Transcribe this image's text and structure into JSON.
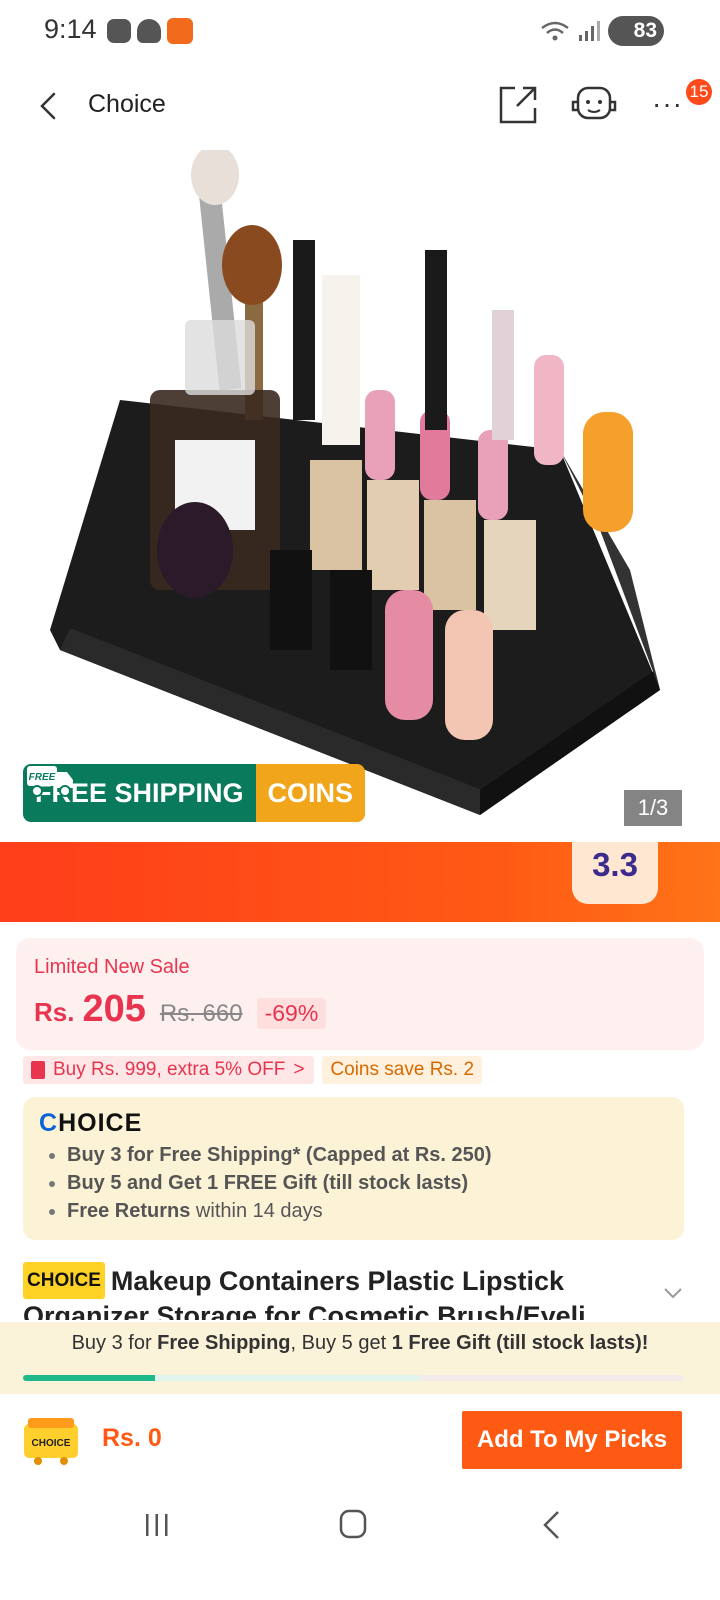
{
  "status_bar": {
    "time": "9:14",
    "battery": "83"
  },
  "header": {
    "title": "Choice",
    "notification_count": "15"
  },
  "gallery": {
    "counter": "1/3",
    "badge_free": "FREE",
    "shipping_label": "FREE SHIPPING",
    "coins_label": "COINS"
  },
  "promo": {
    "badge": "3.3"
  },
  "price": {
    "sale_label": "Limited New Sale",
    "currency": "Rs.",
    "current": "205",
    "original": "Rs. 660",
    "discount": "-69%"
  },
  "coupons": {
    "coupon": "Buy Rs. 999, extra 5% OFF",
    "coupon_chevron": ">",
    "coins": "Coins save Rs. 2"
  },
  "choice_box": {
    "logo": "CHOICE",
    "items": [
      {
        "bold": "Buy 3 for  Free Shipping* (Capped at Rs. 250)",
        "rest": ""
      },
      {
        "bold": "Buy 5 and Get 1 FREE Gift (till stock lasts)",
        "rest": ""
      },
      {
        "bold": "Free Returns",
        "rest": " within 14 days"
      }
    ]
  },
  "product": {
    "choice_badge": "CHOICE",
    "title": "Makeup Containers Plastic Lipstick Organizer Storage for Cosmetic Brush/Eyeli..."
  },
  "bundle": {
    "part1": "Buy 3 for ",
    "part2": "Free Shipping",
    "part3": ", Buy 5 get ",
    "part4": "1 Free Gift (till stock lasts)!",
    "progress": 0.2
  },
  "bottom_bar": {
    "cart_label": "CHOICE",
    "cart_total": "Rs. 0",
    "add_button": "Add To My Picks"
  },
  "colors": {
    "accent": "#ff5a14",
    "price_red": "#e8344e",
    "shipping_green": "#0a7a5c",
    "coins_yellow": "#f0a51a",
    "progress_green": "#1fb88a"
  }
}
